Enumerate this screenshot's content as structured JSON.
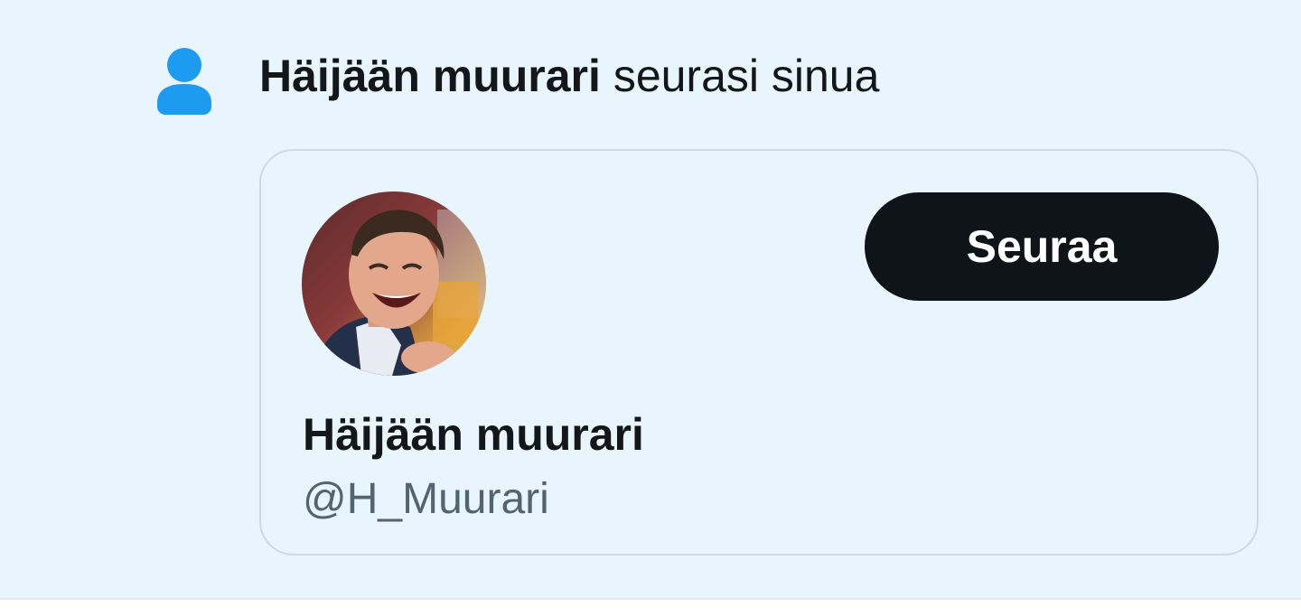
{
  "notification": {
    "icon": "person-icon",
    "actor_name": "Häijään muurari",
    "action_text": "seurasi sinua"
  },
  "user_card": {
    "avatar": "profile-photo",
    "display_name": "Häijään muurari",
    "handle": "@H_Muurari",
    "follow_label": "Seuraa"
  },
  "colors": {
    "background": "#e8f5fd",
    "icon_blue": "#1d9bf0",
    "button_bg": "#0f1419",
    "text_primary": "#14171a",
    "text_secondary": "#536471",
    "border": "#cfd9de"
  }
}
